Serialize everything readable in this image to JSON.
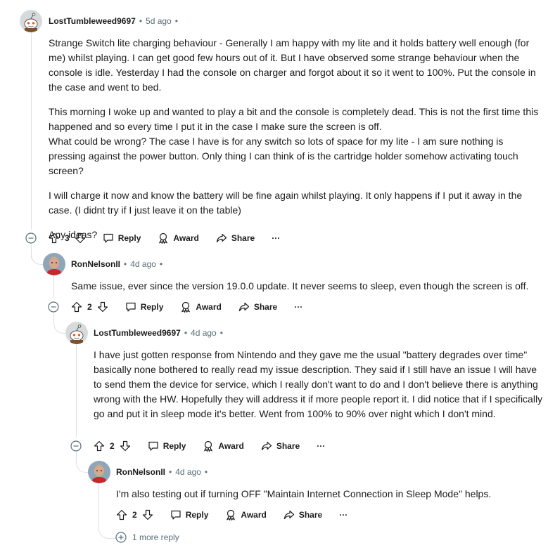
{
  "comments": [
    {
      "author": "LostTumbleweed9697",
      "time": "5d ago",
      "paragraphs": [
        "Strange Switch lite charging behaviour - Generally I am happy with my lite and it holds battery well enough (for me) whilst playing. I can get good few hours out of it. But I have observed some strange behaviour when the console is idle. Yesterday I had the console on charger and forgot about it so it went to 100%. Put the console in the case and went to bed.",
        "This morning I woke up and wanted to play a bit and the console is completely dead. This is not the first time this happened and so every time I put it in the case I make sure the screen is off.\nWhat could be wrong? The case I have is for any switch so lots of space for my lite - I am sure nothing is pressing against the power button. Only thing I can think of is the cartridge holder somehow activating touch screen?",
        "I will charge it now and know the battery will be fine again whilst playing. It only happens if I put it away in the case. (I didnt try if I just leave it on the table)",
        "Any ideas?"
      ],
      "votes": "3"
    },
    {
      "author": "RonNelsonII",
      "time": "4d ago",
      "paragraphs": [
        "Same issue, ever since the version 19.0.0 update. It never seems to sleep, even though the screen is off."
      ],
      "votes": "2"
    },
    {
      "author": "LostTumbleweed9697",
      "time": "4d ago",
      "paragraphs": [
        "I have just gotten response from Nintendo and they gave me the usual \"battery degrades over time\" basically none bothered to really read my issue description. They said if I still have an issue I will have to send them the device for service, which I really don't want to do and I don't believe there is anything wrong with the HW. Hopefully they will address it if more people report it. I did notice that if I specifically go and put it in sleep mode it's better. Went from 100% to 90% over night which I don't mind."
      ],
      "votes": "2"
    },
    {
      "author": "RonNelsonII",
      "time": "4d ago",
      "paragraphs": [
        "I'm also testing out if turning OFF \"Maintain Internet Connection in Sleep Mode\" helps."
      ],
      "votes": "2"
    }
  ],
  "labels": {
    "reply": "Reply",
    "award": "Award",
    "share": "Share",
    "more": "···",
    "dot": "•",
    "more_replies": "1 more reply"
  },
  "colors": {
    "thread_line": "#dcdfe2",
    "meta_text": "#576f76",
    "snoo_bg": "#d7dadc",
    "snoo_accent": "#ff4500"
  }
}
